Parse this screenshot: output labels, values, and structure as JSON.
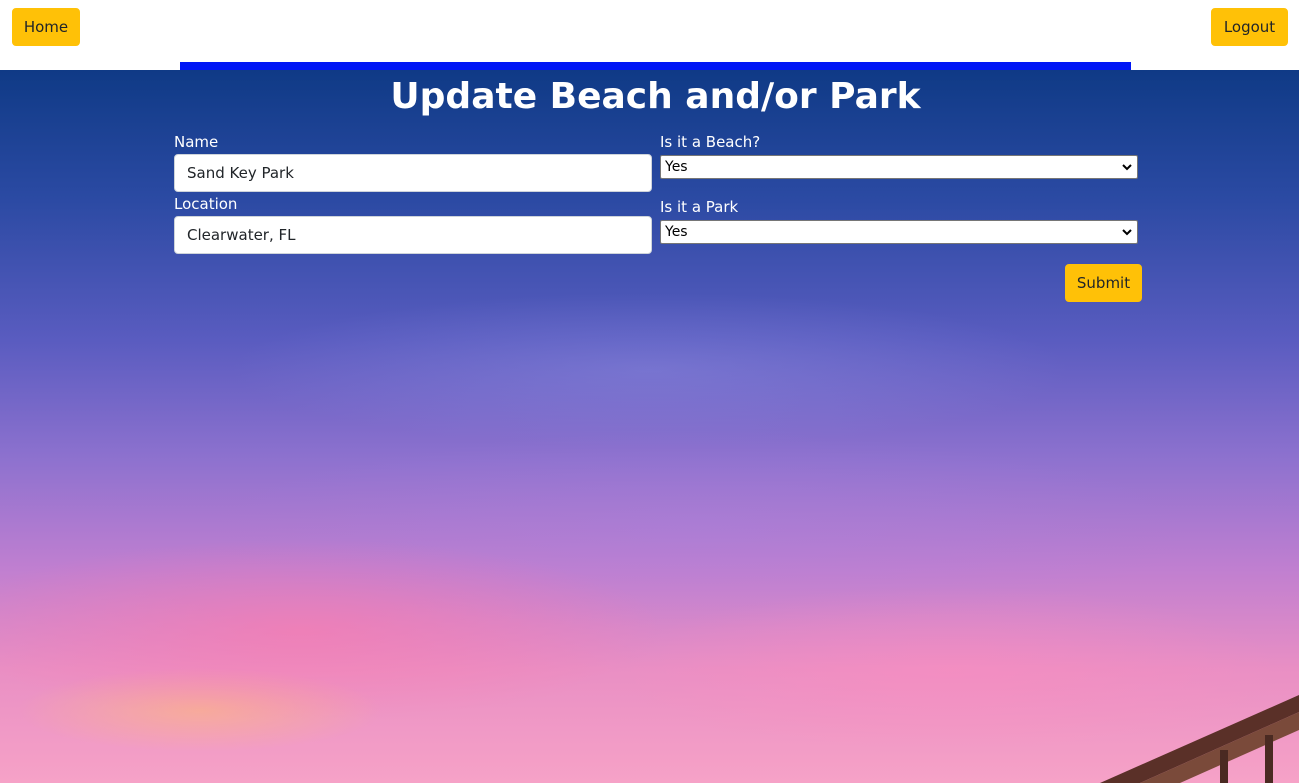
{
  "nav": {
    "home_label": "Home",
    "logout_label": "Logout"
  },
  "form": {
    "title": "Update Beach and/or Park",
    "name_label": "Name",
    "name_value": "Sand Key Park",
    "location_label": "Location",
    "location_value": "Clearwater, FL",
    "beach_label": "Is it a Beach?",
    "beach_value": "Yes",
    "park_label": "Is it a Park",
    "park_value": "Yes",
    "submit_label": "Submit"
  },
  "colors": {
    "button_yellow": "#ffc107",
    "accent_bar_blue": "#0016f5"
  },
  "icons": {
    "select_arrow": "chevron-down-icon"
  }
}
